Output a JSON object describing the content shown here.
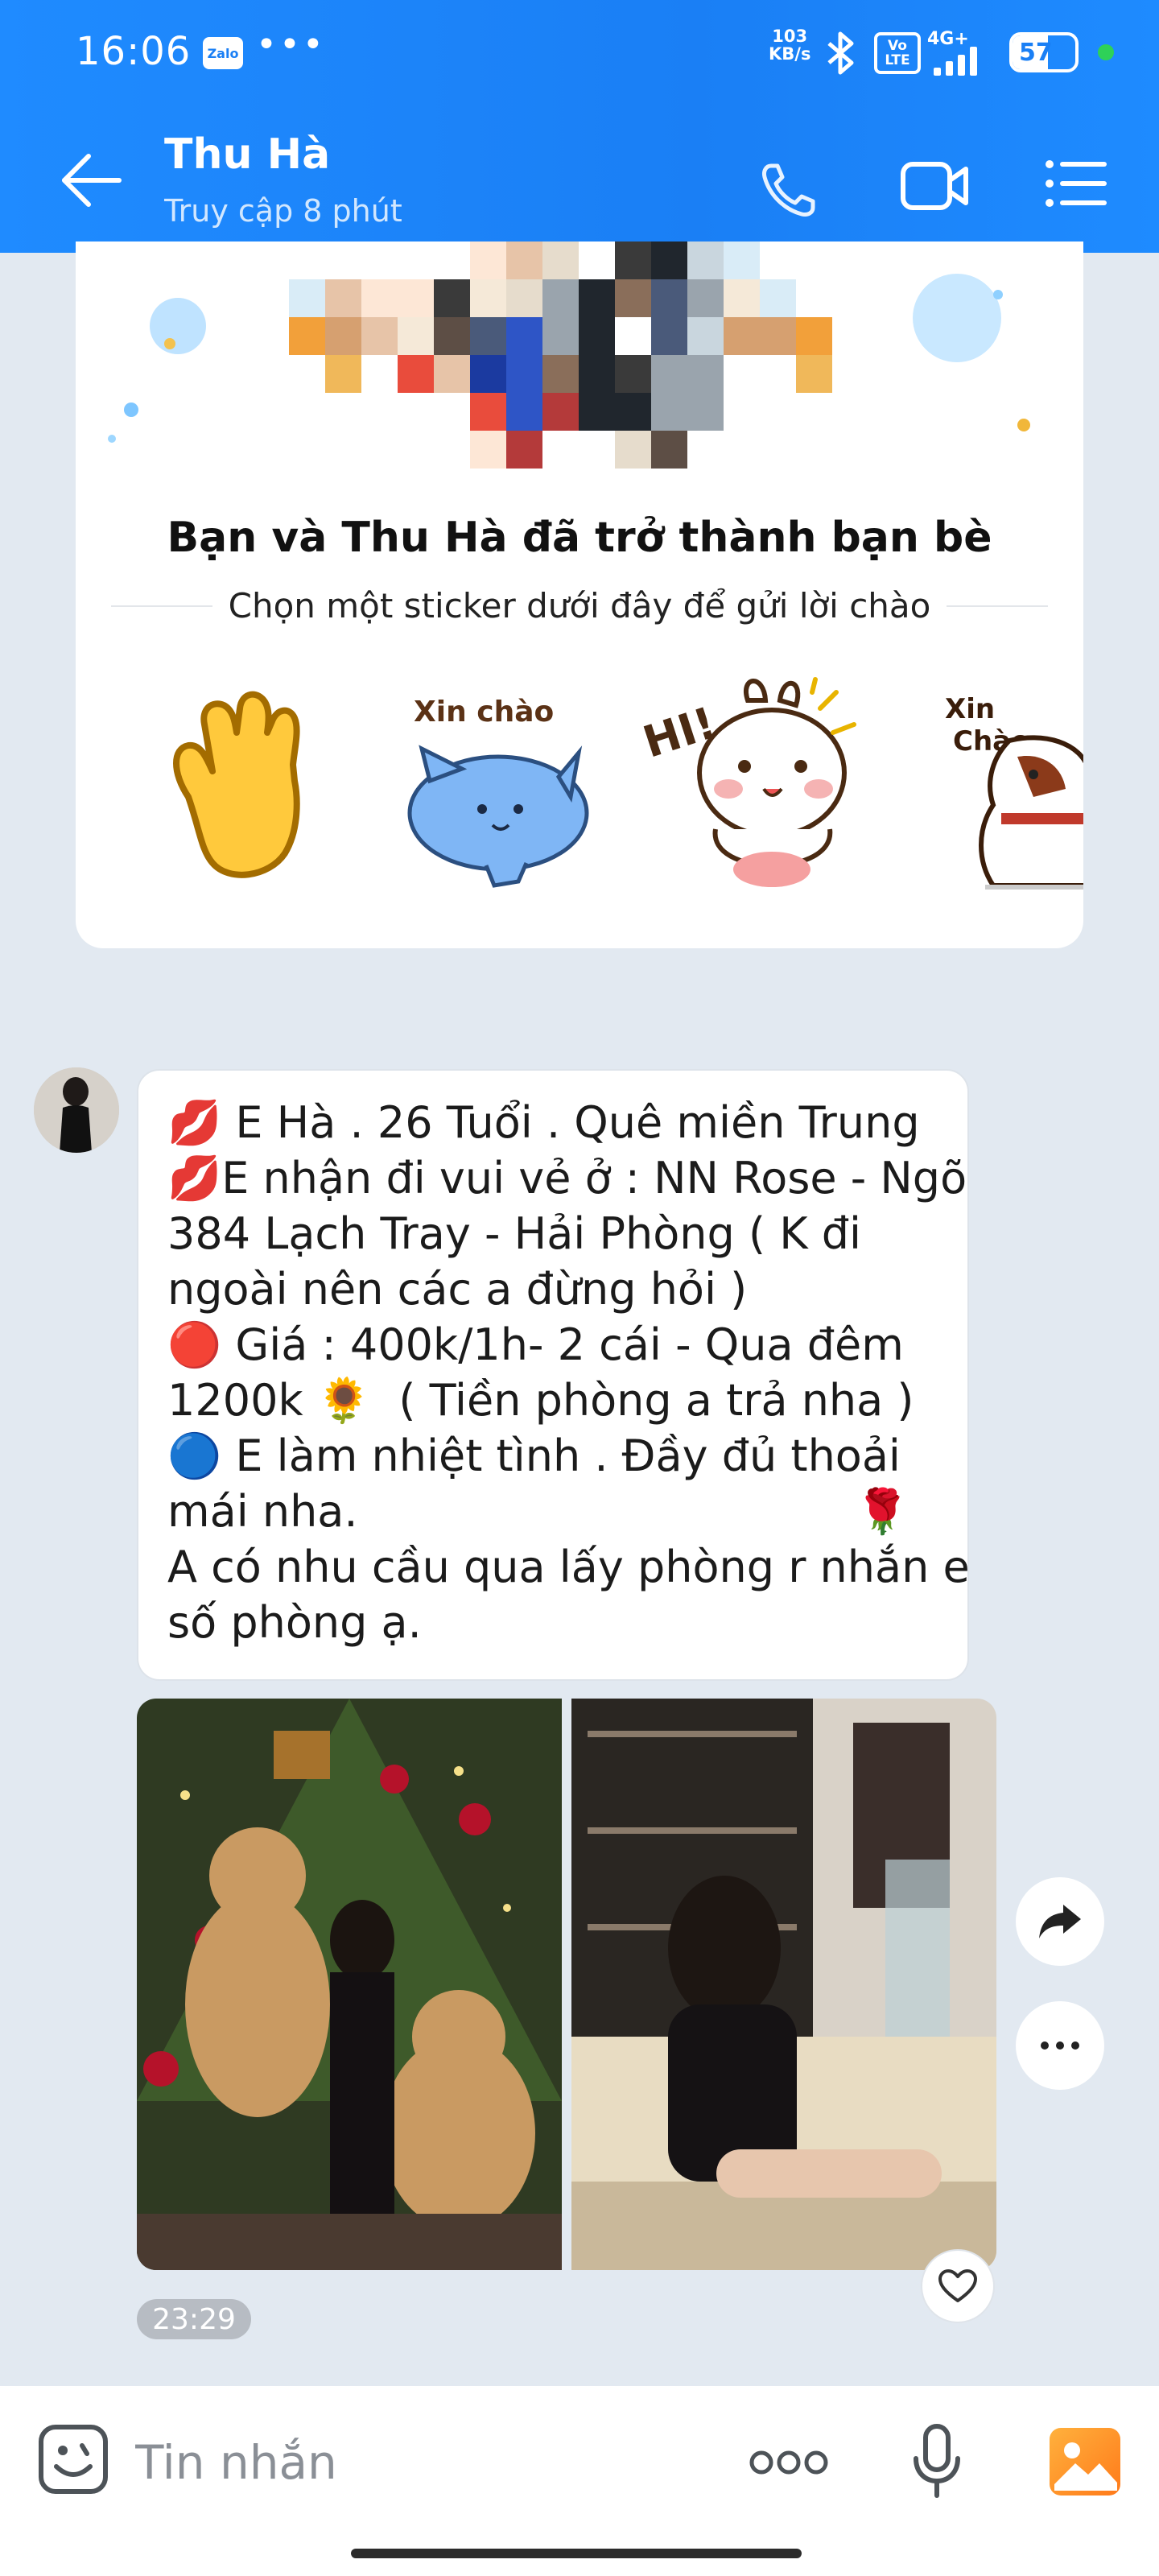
{
  "status_bar": {
    "time": "16:06",
    "zalo_badge": "Zalo",
    "more": "•••",
    "speed_value": "103",
    "speed_unit": "KB/s",
    "volte_top": "Vo",
    "volte_bottom": "LTE",
    "network": "4G+",
    "battery_level": 57,
    "battery_text": "57",
    "dot_color": "#2ed158"
  },
  "header": {
    "contact_name": "Thu Hà",
    "contact_status": "Truy cập 8 phút",
    "back_icon": "arrow-left-icon",
    "call_icon": "phone-icon",
    "video_icon": "video-camera-icon",
    "menu_icon": "menu-list-icon",
    "accent": "#1a7ff5"
  },
  "friend_card": {
    "title": "Bạn và Thu Hà đã trở thành bạn bè",
    "subtitle": "Chọn một sticker dưới đây để gửi lời chào",
    "stickers": [
      {
        "name": "waving-hand-sticker"
      },
      {
        "name": "blue-cat-sticker",
        "label": "Xin chào"
      },
      {
        "name": "bunny-sticker",
        "label": "HI!"
      },
      {
        "name": "dog-sticker",
        "label_line1": "Xin",
        "label_line2": "Chào"
      }
    ]
  },
  "message": {
    "lines": [
      "💋 E Hà . 26 Tuổi . Quê miền Trung",
      "💋E nhận đi vui vẻ ở : NN Rose - Ngõ",
      "384 Lạch Tray - Hải Phòng ( K đi",
      "ngoài nên các a đừng hỏi )",
      "🔴 Giá : 400k/1h- 2 cái - Qua đêm",
      "1200k 🌻  ( Tiền phòng a trả nha )",
      "🔵 E làm nhiệt tình . Đầy đủ thoải",
      "mái nha.                                    🌹",
      "A có nhu cầu qua lấy phòng r nhắn e",
      "số phòng ạ."
    ],
    "time": "23:29",
    "photos": [
      {
        "name": "christmas-tree-photo"
      },
      {
        "name": "cafe-photo"
      }
    ]
  },
  "composer": {
    "placeholder": "Tin nhắn",
    "more_tools": "ooo",
    "emoji_icon": "emoji-icon",
    "mic_icon": "microphone-icon",
    "gallery_icon": "gallery-icon"
  }
}
